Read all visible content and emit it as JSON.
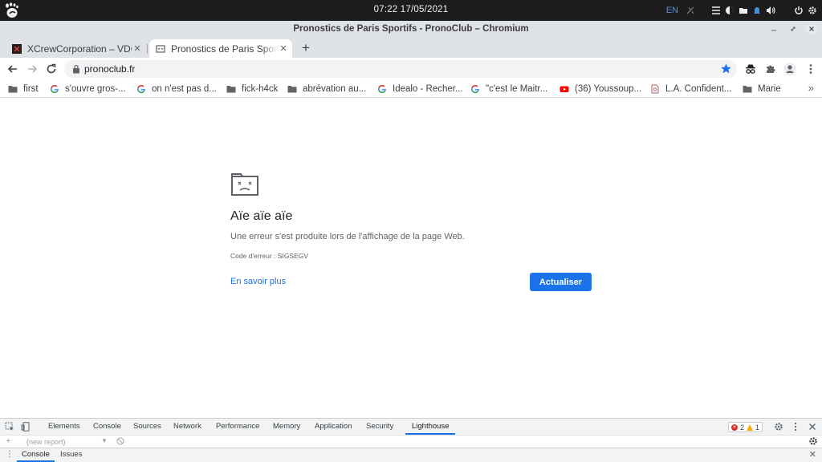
{
  "desktop": {
    "clock": "07:22 17/05/2021",
    "language": "EN"
  },
  "window": {
    "title": "Pronostics de Paris Sportifs - PronoClub – Chromium"
  },
  "tabs": [
    {
      "label": "XCrewCorporation – VDG",
      "active": false
    },
    {
      "label": "Pronostics de Paris Sportifs - PronoClub",
      "active": true
    }
  ],
  "toolbar": {
    "url": "pronoclub.fr"
  },
  "bookmarks": [
    {
      "label": "first",
      "icon": "folder-icon"
    },
    {
      "label": "s'ouvre gros-...",
      "icon": "google-icon"
    },
    {
      "label": "on n'est pas d...",
      "icon": "google-icon"
    },
    {
      "label": "fick-h4ck",
      "icon": "folder-icon"
    },
    {
      "label": "abrévation au...",
      "icon": "folder-icon"
    },
    {
      "label": "Idealo - Recher...",
      "icon": "google-icon"
    },
    {
      "label": "\"c'est le Maitr...",
      "icon": "google-icon"
    },
    {
      "label": "(36) Youssoup...",
      "icon": "youtube-icon"
    },
    {
      "label": "L.A. Confident...",
      "icon": "page-icon"
    },
    {
      "label": "Marie",
      "icon": "folder-icon"
    }
  ],
  "error_page": {
    "title": "Aïe aïe aïe",
    "message": "Une erreur s'est produite lors de l'affichage de la page Web.",
    "code": "Code d'erreur : SIGSEGV",
    "learn_more": "En savoir plus",
    "reload_button": "Actualiser"
  },
  "devtools": {
    "tabs": [
      "Elements",
      "Console",
      "Sources",
      "Network",
      "Performance",
      "Memory",
      "Application",
      "Security",
      "Lighthouse"
    ],
    "active_tab": "Lighthouse",
    "errors": "2",
    "warnings": "1",
    "report_placeholder": "(new report)",
    "drawer_tabs": [
      "Console",
      "Issues"
    ],
    "colors": {
      "accent": "#1a73e8",
      "error": "#d93025",
      "warning": "#f9ab00"
    }
  }
}
